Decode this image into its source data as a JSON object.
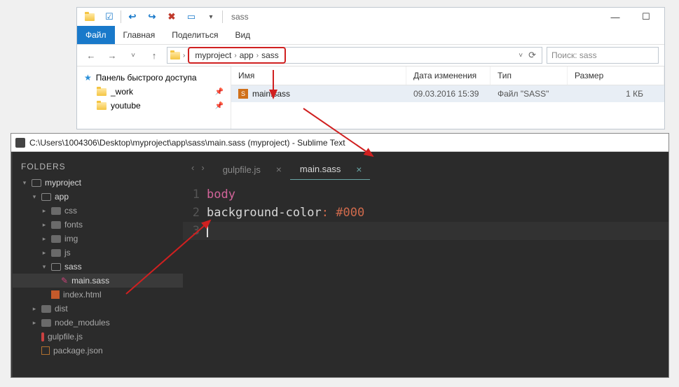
{
  "explorer": {
    "titlebar_location": "sass",
    "menubar": [
      "Файл",
      "Главная",
      "Поделиться",
      "Вид"
    ],
    "breadcrumb": [
      "myproject",
      "app",
      "sass"
    ],
    "search_placeholder": "Поиск: sass",
    "quick_access": {
      "header": "Панель быстрого доступа",
      "items": [
        "_work",
        "youtube"
      ]
    },
    "columns": {
      "name": "Имя",
      "date": "Дата изменения",
      "type": "Тип",
      "size": "Размер"
    },
    "rows": [
      {
        "name": "main.sass",
        "date": "09.03.2016 15:39",
        "type": "Файл \"SASS\"",
        "size": "1 КБ"
      }
    ]
  },
  "sublime": {
    "title": "C:\\Users\\1004306\\Desktop\\myproject\\app\\sass\\main.sass (myproject) - Sublime Text",
    "sidebar_header": "FOLDERS",
    "tree": {
      "root": "myproject",
      "app": "app",
      "app_children": [
        "css",
        "fonts",
        "img",
        "js"
      ],
      "sass": "sass",
      "sass_file": "main.sass",
      "index": "index.html",
      "dist": "dist",
      "node_modules": "node_modules",
      "gulpfile": "gulpfile.js",
      "package": "package.json"
    },
    "tabs": [
      {
        "label": "gulpfile.js",
        "active": false
      },
      {
        "label": "main.sass",
        "active": true
      }
    ],
    "code": {
      "lines": [
        {
          "n": "1",
          "tokens": [
            {
              "t": "body",
              "c": "sel"
            }
          ]
        },
        {
          "n": "2",
          "tokens": [
            {
              "t": "  ",
              "c": ""
            },
            {
              "t": "background-color",
              "c": "prop"
            },
            {
              "t": ": ",
              "c": "colon"
            },
            {
              "t": "#000",
              "c": "val"
            }
          ]
        },
        {
          "n": "3",
          "tokens": []
        }
      ]
    }
  }
}
